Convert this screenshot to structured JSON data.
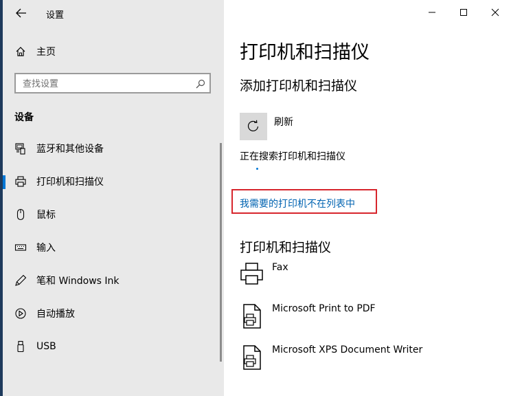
{
  "window": {
    "app_title": "设置"
  },
  "sidebar": {
    "home_label": "主页",
    "search_placeholder": "查找设置",
    "section_heading": "设备",
    "items": [
      {
        "label": "蓝牙和其他设备",
        "icon": "bluetooth-devices-icon"
      },
      {
        "label": "打印机和扫描仪",
        "icon": "printer-icon",
        "selected": true
      },
      {
        "label": "鼠标",
        "icon": "mouse-icon"
      },
      {
        "label": "输入",
        "icon": "keyboard-icon"
      },
      {
        "label": "笔和 Windows Ink",
        "icon": "pen-icon"
      },
      {
        "label": "自动播放",
        "icon": "autoplay-icon"
      },
      {
        "label": "USB",
        "icon": "usb-icon"
      }
    ]
  },
  "main": {
    "page_title": "打印机和扫描仪",
    "add_heading": "添加打印机和扫描仪",
    "refresh_label": "刷新",
    "searching_text": "正在搜索打印机和扫描仪",
    "missing_printer_link": "我需要的打印机不在列表中",
    "printers_heading": "打印机和扫描仪",
    "printers": [
      {
        "name": "Fax",
        "icon": "fax-printer-icon"
      },
      {
        "name": "Microsoft Print to PDF",
        "icon": "document-printer-icon"
      },
      {
        "name": "Microsoft XPS Document Writer",
        "icon": "document-printer-icon"
      }
    ]
  },
  "colors": {
    "accent": "#0078d7",
    "link": "#0063b1",
    "highlight_border": "#d7252c",
    "sidebar_bg": "#e9e9e9"
  }
}
